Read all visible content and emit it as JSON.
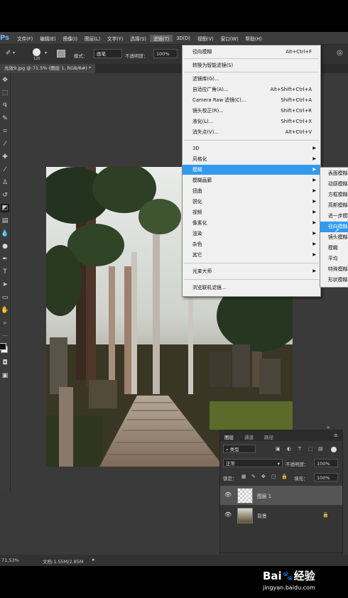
{
  "menubar": {
    "logo": "Ps",
    "items": [
      "文件(F)",
      "编辑(E)",
      "图像(I)",
      "图层(L)",
      "文字(Y)",
      "选择(S)",
      "滤镜(T)",
      "3D(D)",
      "视图(V)",
      "窗口(W)",
      "帮助(H)"
    ]
  },
  "options": {
    "brush_size": "125",
    "mode_label": "模式：",
    "mode_value": "画笔",
    "opacity_label": "不透明度：",
    "opacity_value": "100%"
  },
  "tab": {
    "title": "光效9.jpg @ 71.5% (图层 1, RGB/8#) *"
  },
  "filter_menu": {
    "items": [
      {
        "label": "径向模糊",
        "shortcut": "Alt+Ctrl+F"
      },
      {
        "label": "转换为智能滤镜(S)",
        "shortcut": ""
      },
      {
        "label": "滤镜库(G)...",
        "shortcut": ""
      },
      {
        "label": "自适应广角(A)...",
        "shortcut": "Alt+Shift+Ctrl+A"
      },
      {
        "label": "Camera Raw 滤镜(C)...",
        "shortcut": "Shift+Ctrl+A"
      },
      {
        "label": "镜头校正(R)...",
        "shortcut": "Shift+Ctrl+R"
      },
      {
        "label": "液化(L)...",
        "shortcut": "Shift+Ctrl+X"
      },
      {
        "label": "消失点(V)...",
        "shortcut": "Alt+Ctrl+V"
      },
      {
        "label": "3D",
        "shortcut": ""
      },
      {
        "label": "风格化",
        "shortcut": ""
      },
      {
        "label": "模糊",
        "shortcut": ""
      },
      {
        "label": "模糊画廊",
        "shortcut": ""
      },
      {
        "label": "扭曲",
        "shortcut": ""
      },
      {
        "label": "锐化",
        "shortcut": ""
      },
      {
        "label": "视频",
        "shortcut": ""
      },
      {
        "label": "像素化",
        "shortcut": ""
      },
      {
        "label": "渲染",
        "shortcut": ""
      },
      {
        "label": "杂色",
        "shortcut": ""
      },
      {
        "label": "其它",
        "shortcut": ""
      },
      {
        "label": "光束大师",
        "shortcut": ""
      },
      {
        "label": "浏览联机滤镜...",
        "shortcut": ""
      }
    ]
  },
  "blur_submenu": {
    "items": [
      "表面模糊...",
      "动感模糊...",
      "方框模糊...",
      "高斯模糊...",
      "进一步模糊",
      "径向模糊...",
      "镜头模糊...",
      "模糊",
      "平均",
      "特殊模糊...",
      "形状模糊..."
    ]
  },
  "layers_panel": {
    "tabs": [
      "图层",
      "通道",
      "路径"
    ],
    "filter_kind": "类型",
    "blend_mode": "正常",
    "opacity_label": "不透明度：",
    "opacity_value": "100%",
    "lock_label": "锁定：",
    "fill_label": "填充：",
    "fill_value": "100%",
    "layers": [
      {
        "name": "图层 1"
      },
      {
        "name": "背景"
      }
    ]
  },
  "status": {
    "zoom": "71.53%",
    "doc": "文档:1.55M/2.85M"
  },
  "watermark": {
    "brand_left": "Bai",
    "brand_right": "经验",
    "url": "jingyan.baidu.com"
  }
}
